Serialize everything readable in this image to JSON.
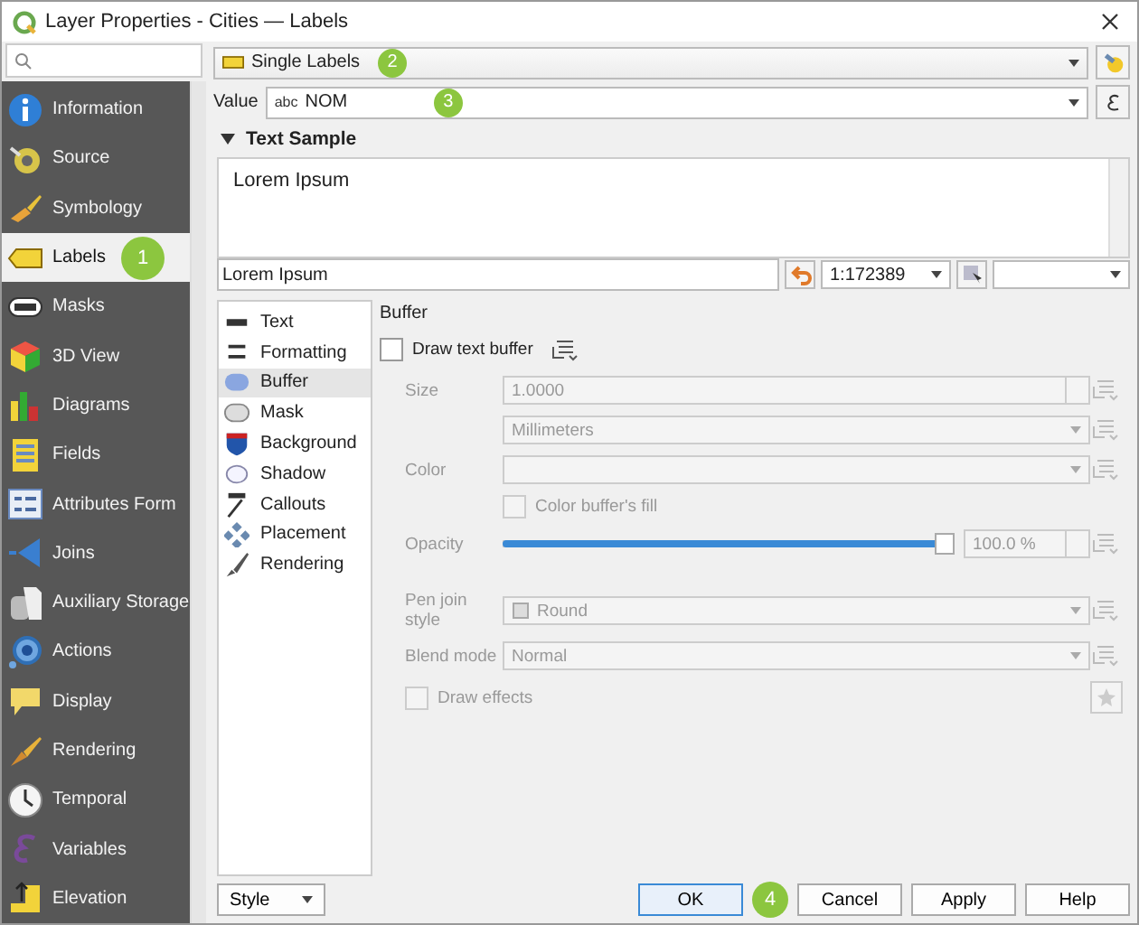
{
  "window": {
    "title": "Layer Properties - Cities — Labels"
  },
  "sidebar": {
    "items": [
      {
        "label": "Information",
        "selected": false
      },
      {
        "label": "Source",
        "selected": false
      },
      {
        "label": "Symbology",
        "selected": false
      },
      {
        "label": "Labels",
        "selected": true,
        "badge": "1"
      },
      {
        "label": "Masks",
        "selected": false
      },
      {
        "label": "3D View",
        "selected": false
      },
      {
        "label": "Diagrams",
        "selected": false
      },
      {
        "label": "Fields",
        "selected": false
      },
      {
        "label": "Attributes Form",
        "selected": false
      },
      {
        "label": "Joins",
        "selected": false
      },
      {
        "label": "Auxiliary Storage",
        "selected": false
      },
      {
        "label": "Actions",
        "selected": false
      },
      {
        "label": "Display",
        "selected": false
      },
      {
        "label": "Rendering",
        "selected": false
      },
      {
        "label": "Temporal",
        "selected": false
      },
      {
        "label": "Variables",
        "selected": false
      },
      {
        "label": "Elevation",
        "selected": false
      }
    ]
  },
  "renderer": {
    "value": "Single Labels",
    "badge": "2"
  },
  "value_row": {
    "label": "Value",
    "prefix": "abc",
    "value": "NOM",
    "badge": "3"
  },
  "text_sample": {
    "header": "Text Sample",
    "expanded": true,
    "preview": "Lorem Ipsum",
    "input": "Lorem Ipsum",
    "scale": "1:172389"
  },
  "tabs": [
    {
      "label": "Text",
      "selected": false
    },
    {
      "label": "Formatting",
      "selected": false
    },
    {
      "label": "Buffer",
      "selected": true
    },
    {
      "label": "Mask",
      "selected": false
    },
    {
      "label": "Background",
      "selected": false
    },
    {
      "label": "Shadow",
      "selected": false
    },
    {
      "label": "Callouts",
      "selected": false
    },
    {
      "label": "Placement",
      "selected": false
    },
    {
      "label": "Rendering",
      "selected": false
    }
  ],
  "buffer": {
    "title": "Buffer",
    "disabled": true,
    "draw_buffer": {
      "label": "Draw text buffer",
      "checked": false
    },
    "size": {
      "label": "Size",
      "value": "1.0000",
      "units": "Millimeters"
    },
    "color": {
      "label": "Color"
    },
    "color_fill": {
      "label": "Color buffer's fill",
      "checked": false
    },
    "opacity": {
      "label": "Opacity",
      "level": 1,
      "reading": "100.0 %"
    },
    "pen_join": {
      "label": "Pen join style",
      "value": "Round"
    },
    "blend": {
      "label": "Blend mode",
      "value": "Normal"
    },
    "draw_effects": {
      "label": "Draw effects",
      "checked": false
    }
  },
  "footer": {
    "style": "Style",
    "buttons": [
      {
        "label": "OK",
        "badge": "4"
      },
      {
        "label": "Cancel"
      },
      {
        "label": "Apply"
      },
      {
        "label": "Help"
      }
    ]
  }
}
